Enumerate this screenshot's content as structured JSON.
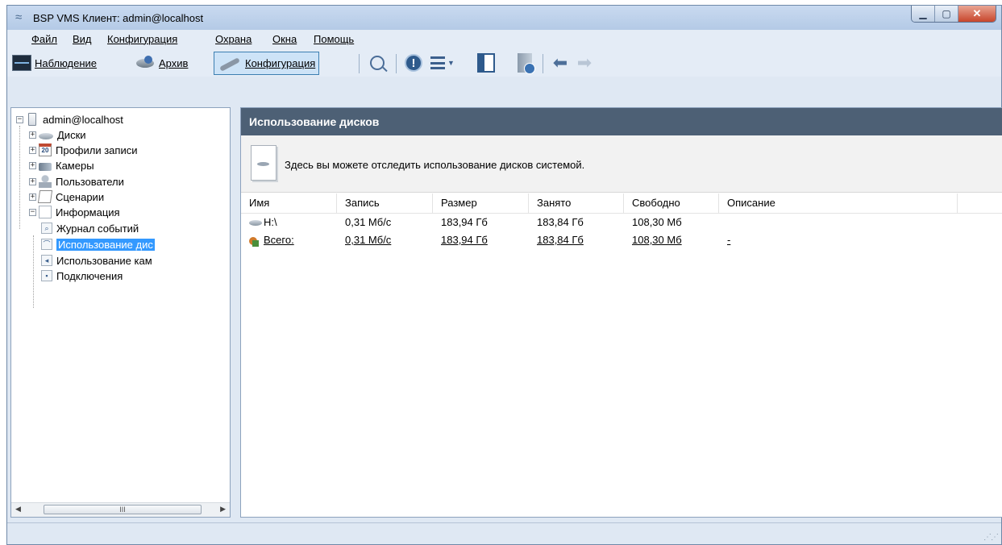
{
  "window": {
    "title": "BSP VMS Клиент: admin@localhost"
  },
  "menu": [
    "Файл",
    "Вид",
    "Конфигурация",
    "Охрана",
    "Окна",
    "Помощь"
  ],
  "toolbar": {
    "monitoring": "Наблюдение",
    "archive": "Архив",
    "configuration": "Конфигурация"
  },
  "tree": {
    "root": "admin@localhost",
    "items": [
      "Диски",
      "Профили записи",
      "Камеры",
      "Пользователи",
      "Сценарии",
      "Информация"
    ],
    "calendar_number": "20",
    "info_children": [
      "Журнал событий",
      "Использование дис",
      "Использование кам",
      "Подключения"
    ],
    "scroll_grip": "III"
  },
  "panel": {
    "header": "Использование дисков",
    "info": "Здесь вы можете отследить использование дисков системой."
  },
  "table": {
    "columns": [
      "Имя",
      "Запись",
      "Размер",
      "Занято",
      "Свободно",
      "Описание"
    ],
    "rows": [
      {
        "name": "H:\\",
        "record": "0,31 Мб/с",
        "size": "183,94 Гб",
        "used": "183,84 Гб",
        "free": "108,30 Мб",
        "desc": ""
      },
      {
        "name": "Всего:",
        "record": "0,31 Мб/с",
        "size": "183,94 Гб",
        "used": "183,84 Гб",
        "free": "108,30 Мб",
        "desc": "-"
      }
    ]
  },
  "colors": {
    "header_bg": "#4d6075",
    "selection": "#3399ff",
    "frame": "#dfe8f3"
  }
}
